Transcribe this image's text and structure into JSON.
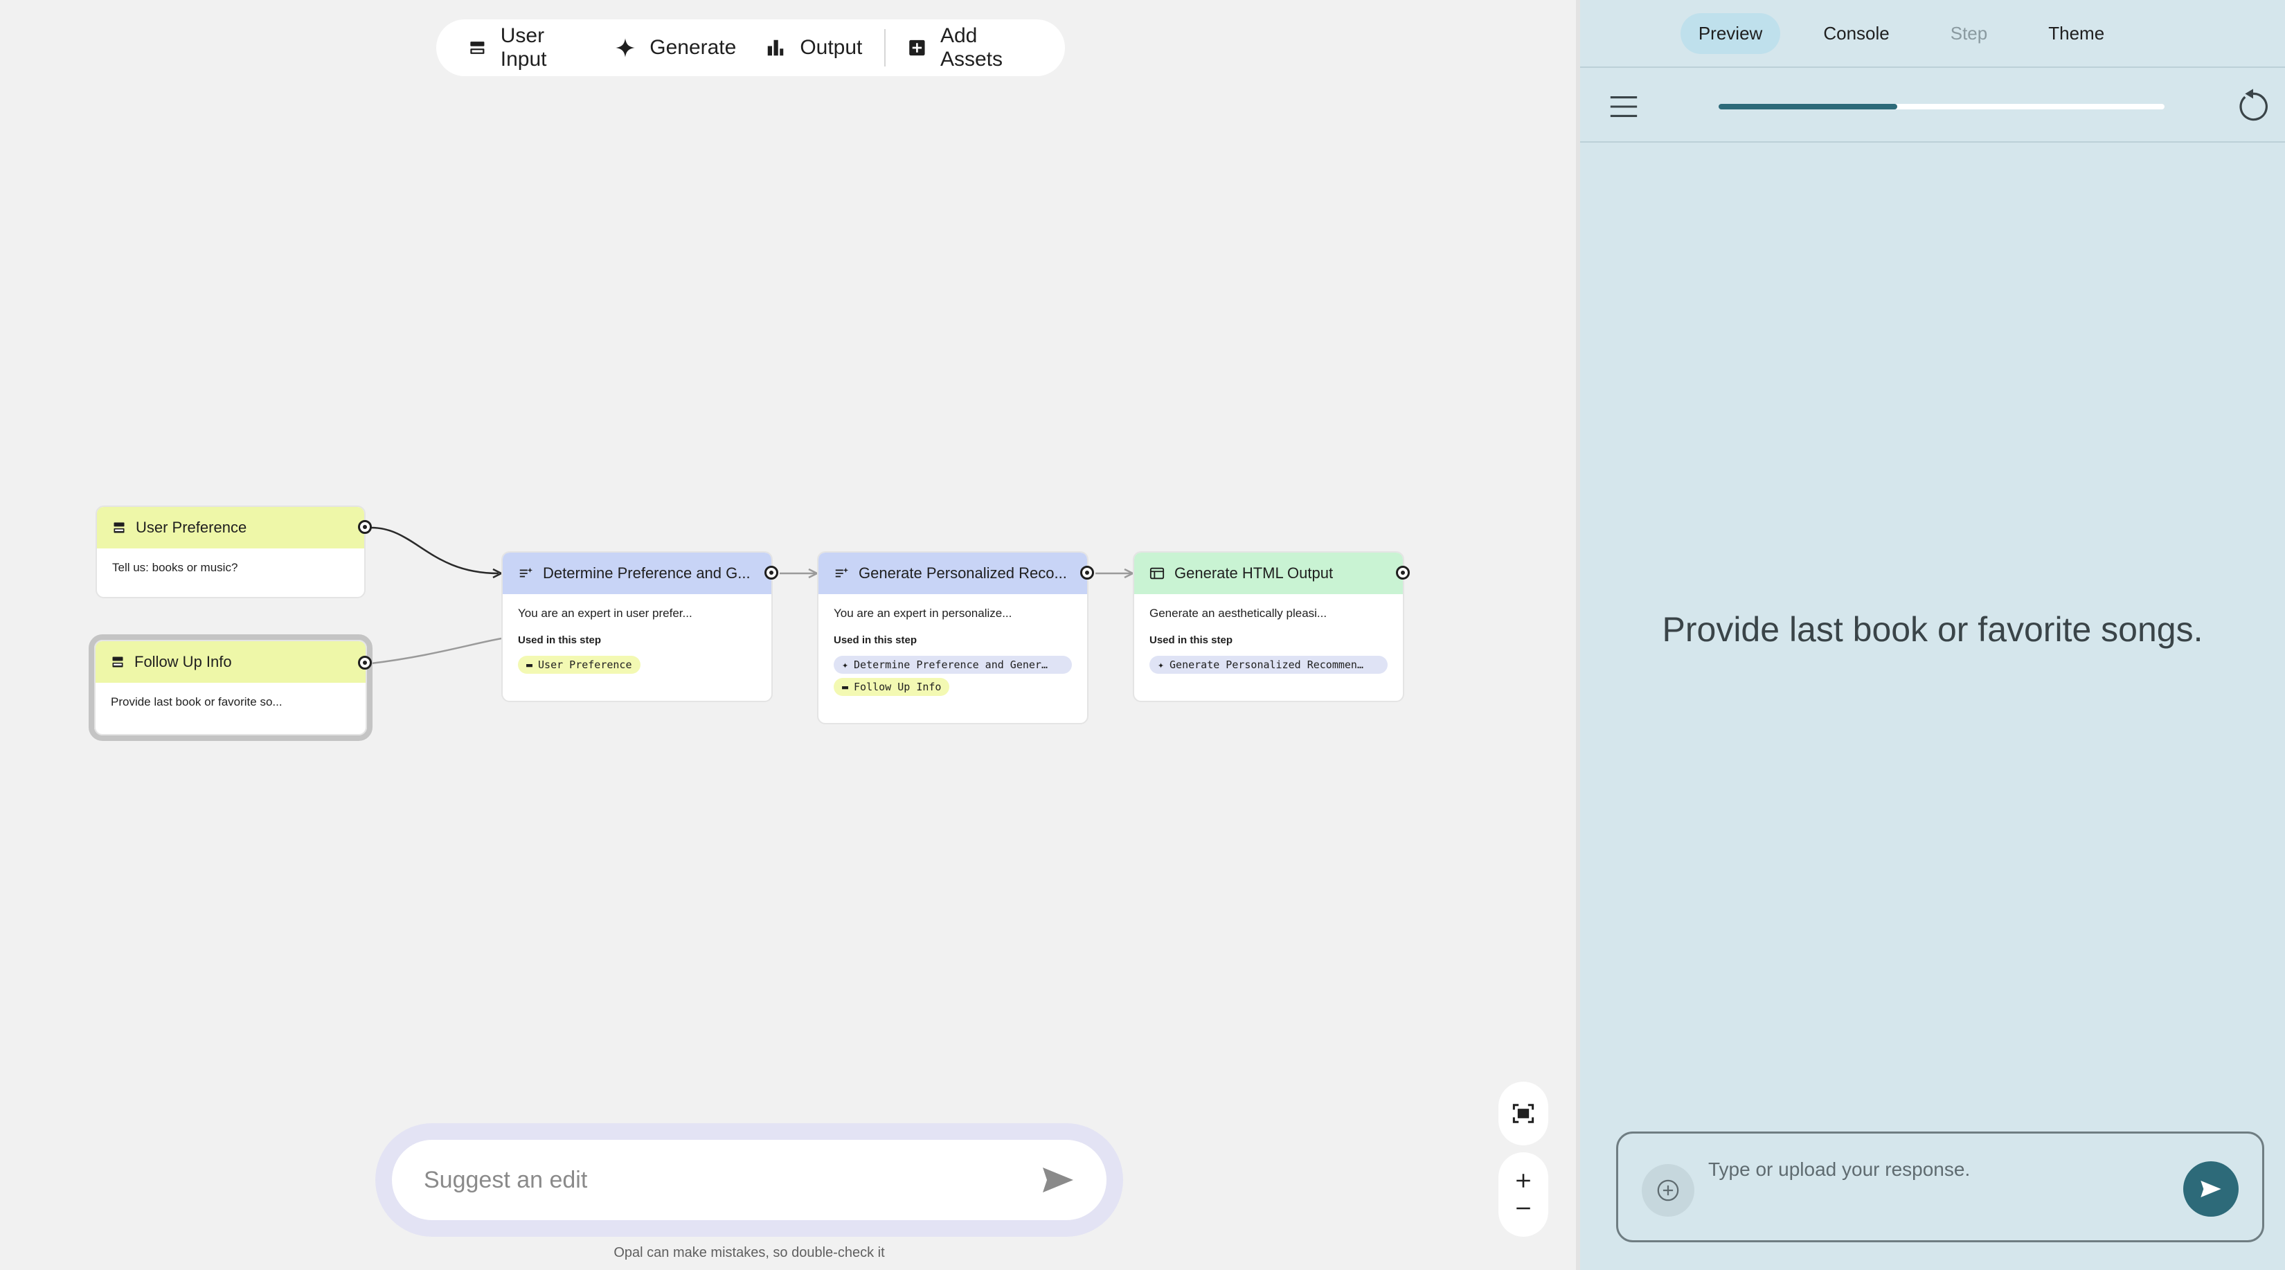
{
  "toolbar": {
    "items": [
      {
        "label": "User Input",
        "icon": "user-input-icon"
      },
      {
        "label": "Generate",
        "icon": "sparkle-icon"
      },
      {
        "label": "Output",
        "icon": "output-icon"
      },
      {
        "label": "Add Assets",
        "icon": "add-box-icon"
      }
    ]
  },
  "nodes": {
    "user_preference": {
      "title": "User Preference",
      "desc": "Tell us: books or music?"
    },
    "follow_up": {
      "title": "Follow Up Info",
      "desc": "Provide last book or favorite so..."
    },
    "determine": {
      "title": "Determine Preference and G...",
      "desc": "You are an expert in user prefer...",
      "used_label": "Used in this step",
      "chips": [
        "User Preference"
      ]
    },
    "generate_reco": {
      "title": "Generate Personalized Reco...",
      "desc": "You are an expert in personalize...",
      "used_label": "Used in this step",
      "chips": [
        "Determine Preference and Gener…",
        "Follow Up Info"
      ]
    },
    "html_output": {
      "title": "Generate HTML Output",
      "desc": "Generate an aesthetically pleasi...",
      "used_label": "Used in this step",
      "chips": [
        "Generate Personalized Recommen…"
      ]
    }
  },
  "colors": {
    "input_node": "#eef7a8",
    "generate_node": "#c8d4f6",
    "output_node": "#c9f3d3",
    "accent": "#2d6a79"
  },
  "suggest": {
    "placeholder": "Suggest an edit",
    "disclaimer": "Opal can make mistakes, so double-check it"
  },
  "right_panel": {
    "tabs": [
      {
        "label": "Preview",
        "state": "active"
      },
      {
        "label": "Console",
        "state": "normal"
      },
      {
        "label": "Step",
        "state": "disabled"
      },
      {
        "label": "Theme",
        "state": "normal"
      }
    ],
    "progress": 0.4,
    "prompt": "Provide last book or favorite songs.",
    "input_placeholder": "Type or upload your response."
  }
}
